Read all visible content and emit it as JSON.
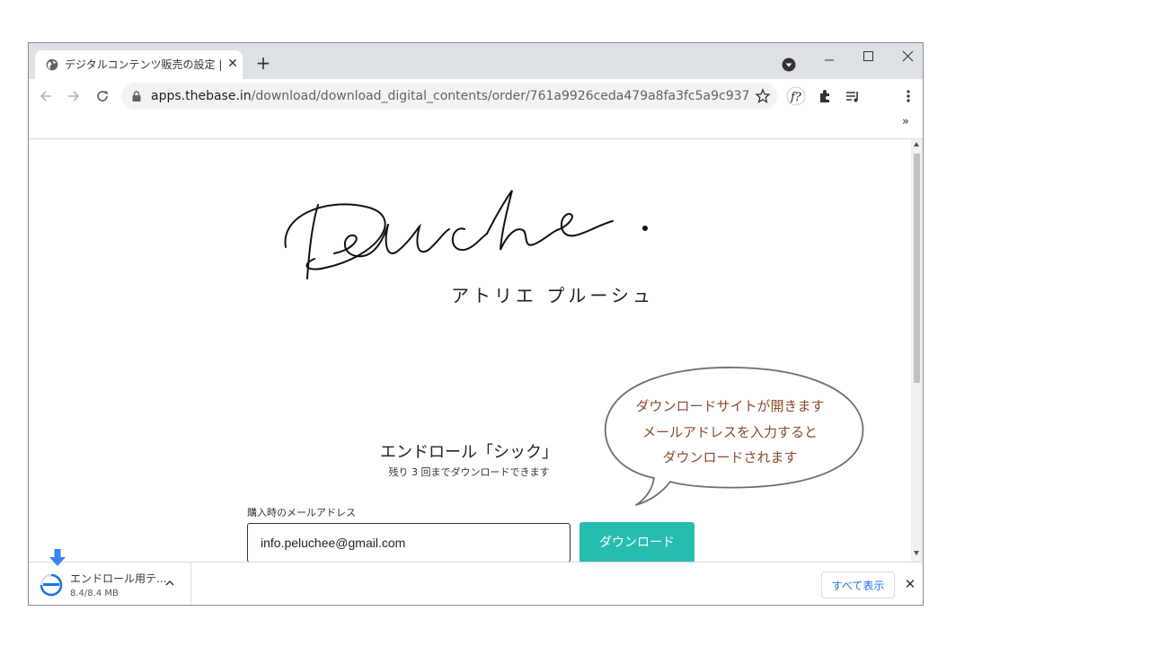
{
  "browser": {
    "tab": {
      "title": "デジタルコンテンツ販売の設定 | BASE",
      "close": "✕"
    },
    "new_tab": "+",
    "address": {
      "host": "apps.thebase.in",
      "path": "/download/download_digital_contents/order/761a9926ceda479a8fa3fc5a9c937"
    },
    "bookmarks_overflow": "»"
  },
  "page": {
    "logo_script": "Peluche.",
    "logo_subtitle": "アトリエ プルーシュ",
    "product_title": "エンドロール「シック」",
    "remaining": "残り 3 回までダウンロードできます",
    "email_label": "購入時のメールアドレス",
    "email_value": "info.peluchee@gmail.com",
    "download_button": "ダウンロード"
  },
  "callout": {
    "lines": [
      "ダウンロードサイトが開きます",
      "メールアドレスを入力すると",
      "ダウンロードされます"
    ]
  },
  "download_shelf": {
    "file_name": "エンドロール用テ...",
    "size": "8.4/8.4 MB",
    "show_all": "すべて表示",
    "close": "✕"
  },
  "colors": {
    "accent_button": "#27bcb0",
    "callout_text": "#8a4a2a",
    "link_blue": "#1a73e8",
    "download_arrow": "#3b82f6"
  }
}
